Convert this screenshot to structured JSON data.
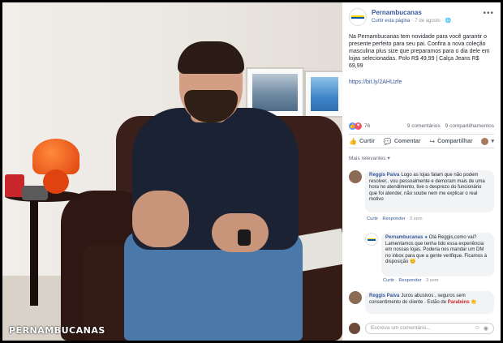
{
  "photo": {
    "watermark": "PERNAMBUCANAS"
  },
  "post": {
    "page_name": "Pernambucanas",
    "like_page": "Curtir esta página",
    "date": "7 de agosto",
    "more": "•••",
    "text": "Na Pernambucanas tem novidade para você garantir o presente perfeito para seu pai. Confira a nova coleção masculina plus size que preparamos para o dia dele em lojas selecionadas. Polo R$ 49,99 | Calça Jeans R$ 69,99",
    "link": "https://bit.ly/2AHUzfe"
  },
  "reactions": {
    "count": "76",
    "comments": "9 comentários",
    "shares": "9 compartilhamentos"
  },
  "actions": {
    "like": "Curtir",
    "comment": "Comentar",
    "share": "Compartilhar"
  },
  "filter": "Mais relevantes",
  "comments": [
    {
      "name": "Reggis Paiva",
      "text": "Logo as lojas falam que não podem resolver.. vou pessoalmente e demoram mais de uma hora no atendimento, tive o desprezo do funcionário que foi atender, não soube nem me explicar o real motivo",
      "actions": {
        "like": "Curtir",
        "reply": "Responder",
        "time": "3 sem"
      }
    },
    {
      "name": "Pernambucanas",
      "text": "Olá Reggis,como vai? Lamentamos que tenha tido essa experiência em nossas lojas. Poderia nos mandar um DM no inbox para que a gente verifique. Ficamos à disposição",
      "emoji": "😊",
      "actions": {
        "like": "Curtir",
        "reply": "Responder",
        "time": "3 sem"
      }
    },
    {
      "name": "Reggis Paiva",
      "text": "Juros abusivos , seguros sem consentimento do cliente . Estão de",
      "tag": "Parabéns",
      "emoji": "👏"
    }
  ],
  "compose": {
    "placeholder": "Escreva um comentário..."
  },
  "icons": {
    "like": "thumbs-up-icon",
    "comment": "speech-bubble-icon",
    "share": "share-arrow-icon",
    "more": "ellipsis-icon",
    "globe": "globe-icon"
  },
  "colors": {
    "fb_blue": "#365899",
    "brand_blue": "#0c5aa6",
    "brand_yellow": "#ffd200",
    "tag_red": "#c8262b"
  }
}
